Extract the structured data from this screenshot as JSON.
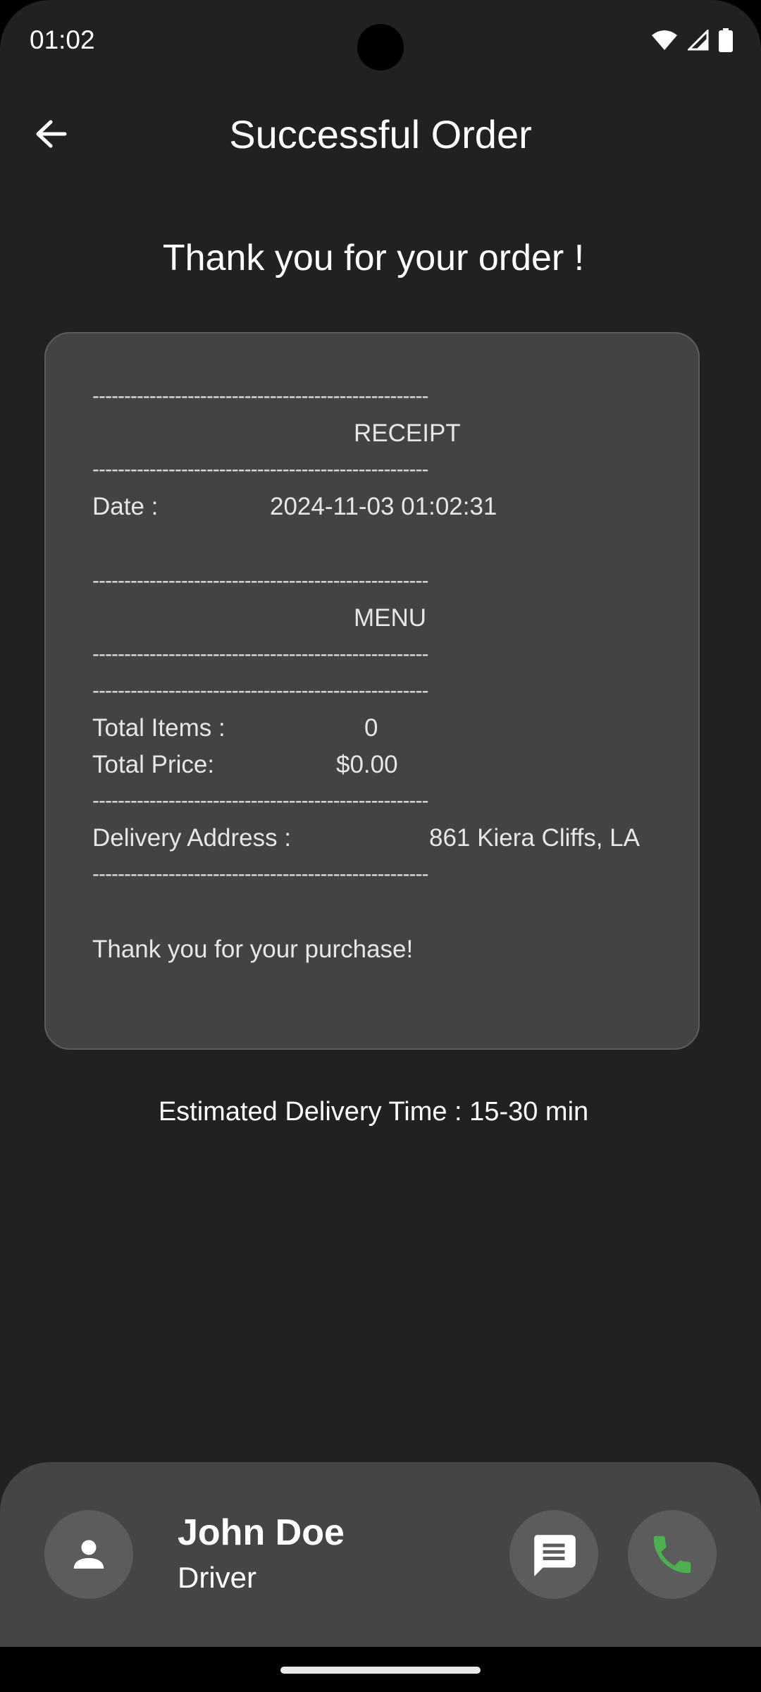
{
  "status_bar": {
    "time": "01:02"
  },
  "app_bar": {
    "title": "Successful Order"
  },
  "heading": "Thank you for your order !",
  "receipt": {
    "divider": "-----------------------------------------------------",
    "receipt_label": "RECEIPT",
    "date_label": "Date :",
    "date_value": "2024-11-03 01:02:31",
    "menu_label": "MENU",
    "total_items_label": "Total Items :",
    "total_items_value": "0",
    "total_price_label": "Total Price:",
    "total_price_value": "$0.00",
    "address_label": "Delivery Address :",
    "address_value": "861 Kiera Cliffs, LA",
    "thanks": "Thank you for your purchase!"
  },
  "eta": "Estimated Delivery Time : 15-30 min",
  "driver": {
    "name": "John Doe",
    "role": "Driver"
  },
  "colors": {
    "background": "#212121",
    "card": "#434343",
    "panel": "#454545",
    "call_icon": "#4caf50"
  },
  "icons": {
    "back": "arrow-left",
    "avatar": "person",
    "message": "chat-bubble",
    "call": "phone"
  }
}
